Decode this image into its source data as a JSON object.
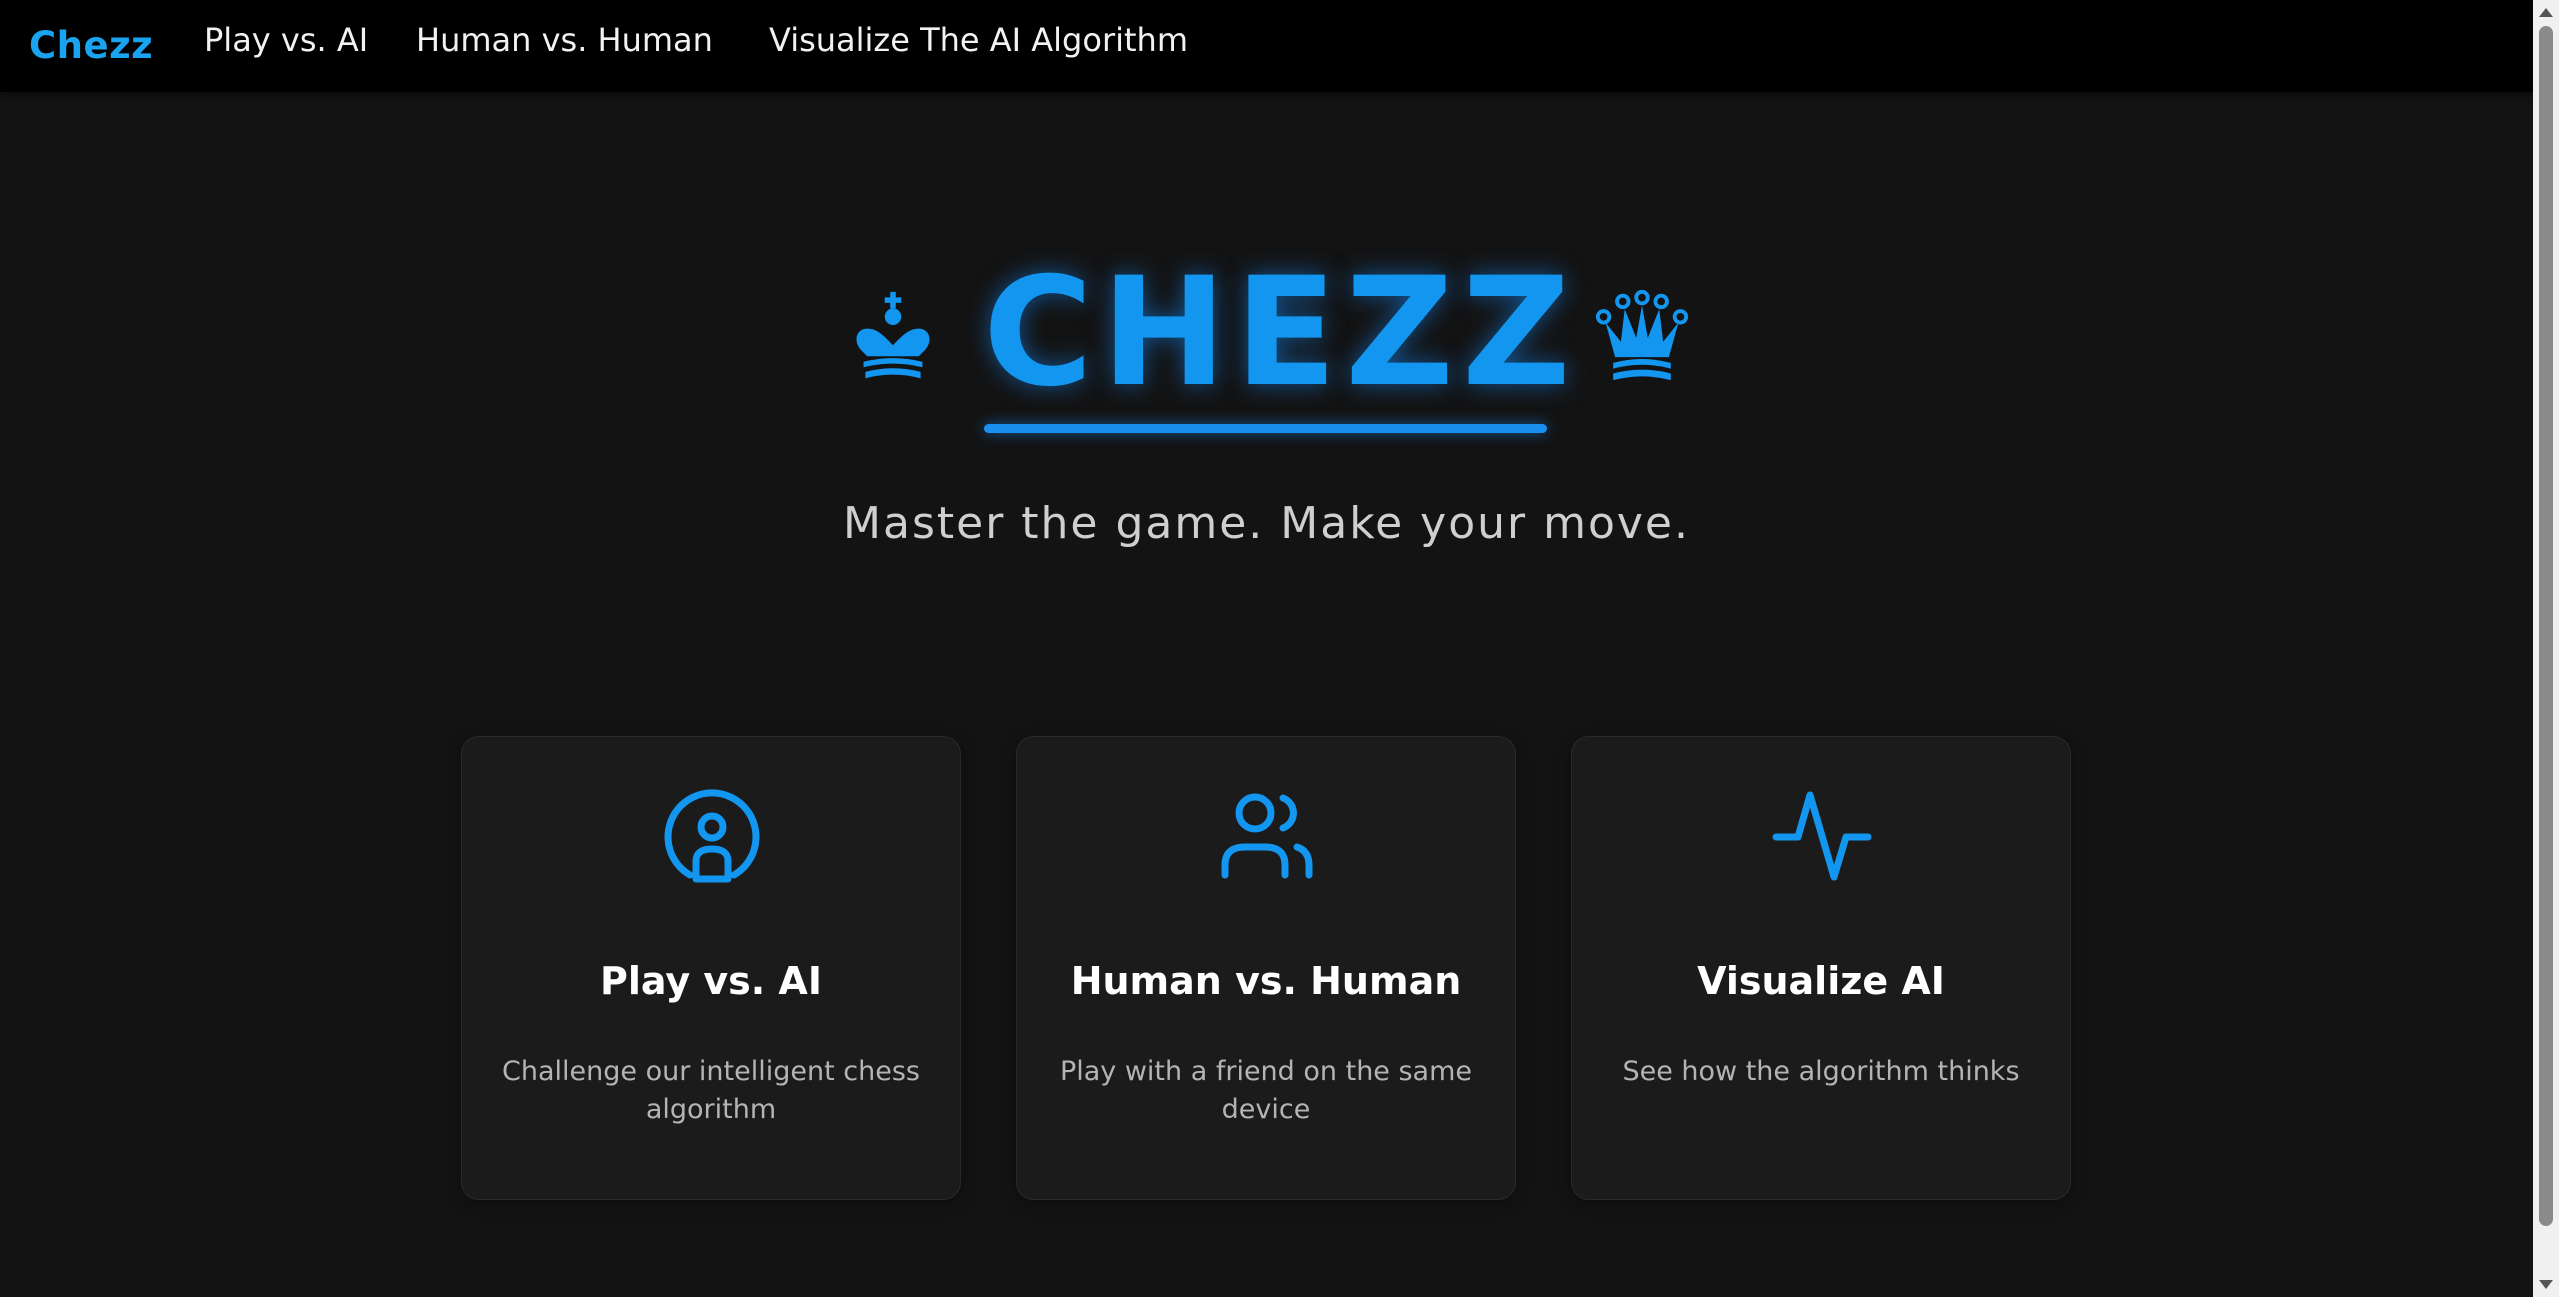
{
  "navbar": {
    "brand": "Chezz",
    "links": [
      "Play vs. AI",
      "Human vs. Human",
      "Visualize The AI Algorithm"
    ]
  },
  "hero": {
    "title": "CHEZZ",
    "left_icon": "king-icon",
    "right_icon": "queen-icon",
    "tagline": "Master the game. Make your move."
  },
  "cards": [
    {
      "icon": "robot-icon",
      "title": "Play vs. AI",
      "description": "Challenge our intelligent chess algorithm"
    },
    {
      "icon": "users-icon",
      "title": "Human vs. Human",
      "description": "Play with a friend on the same device"
    },
    {
      "icon": "activity-icon",
      "title": "Visualize AI",
      "description": "See how the algorithm thinks"
    }
  ],
  "colors": {
    "accent": "#1296f0",
    "background": "#131313",
    "navbar": "#000000",
    "card": "#1b1b1b"
  }
}
